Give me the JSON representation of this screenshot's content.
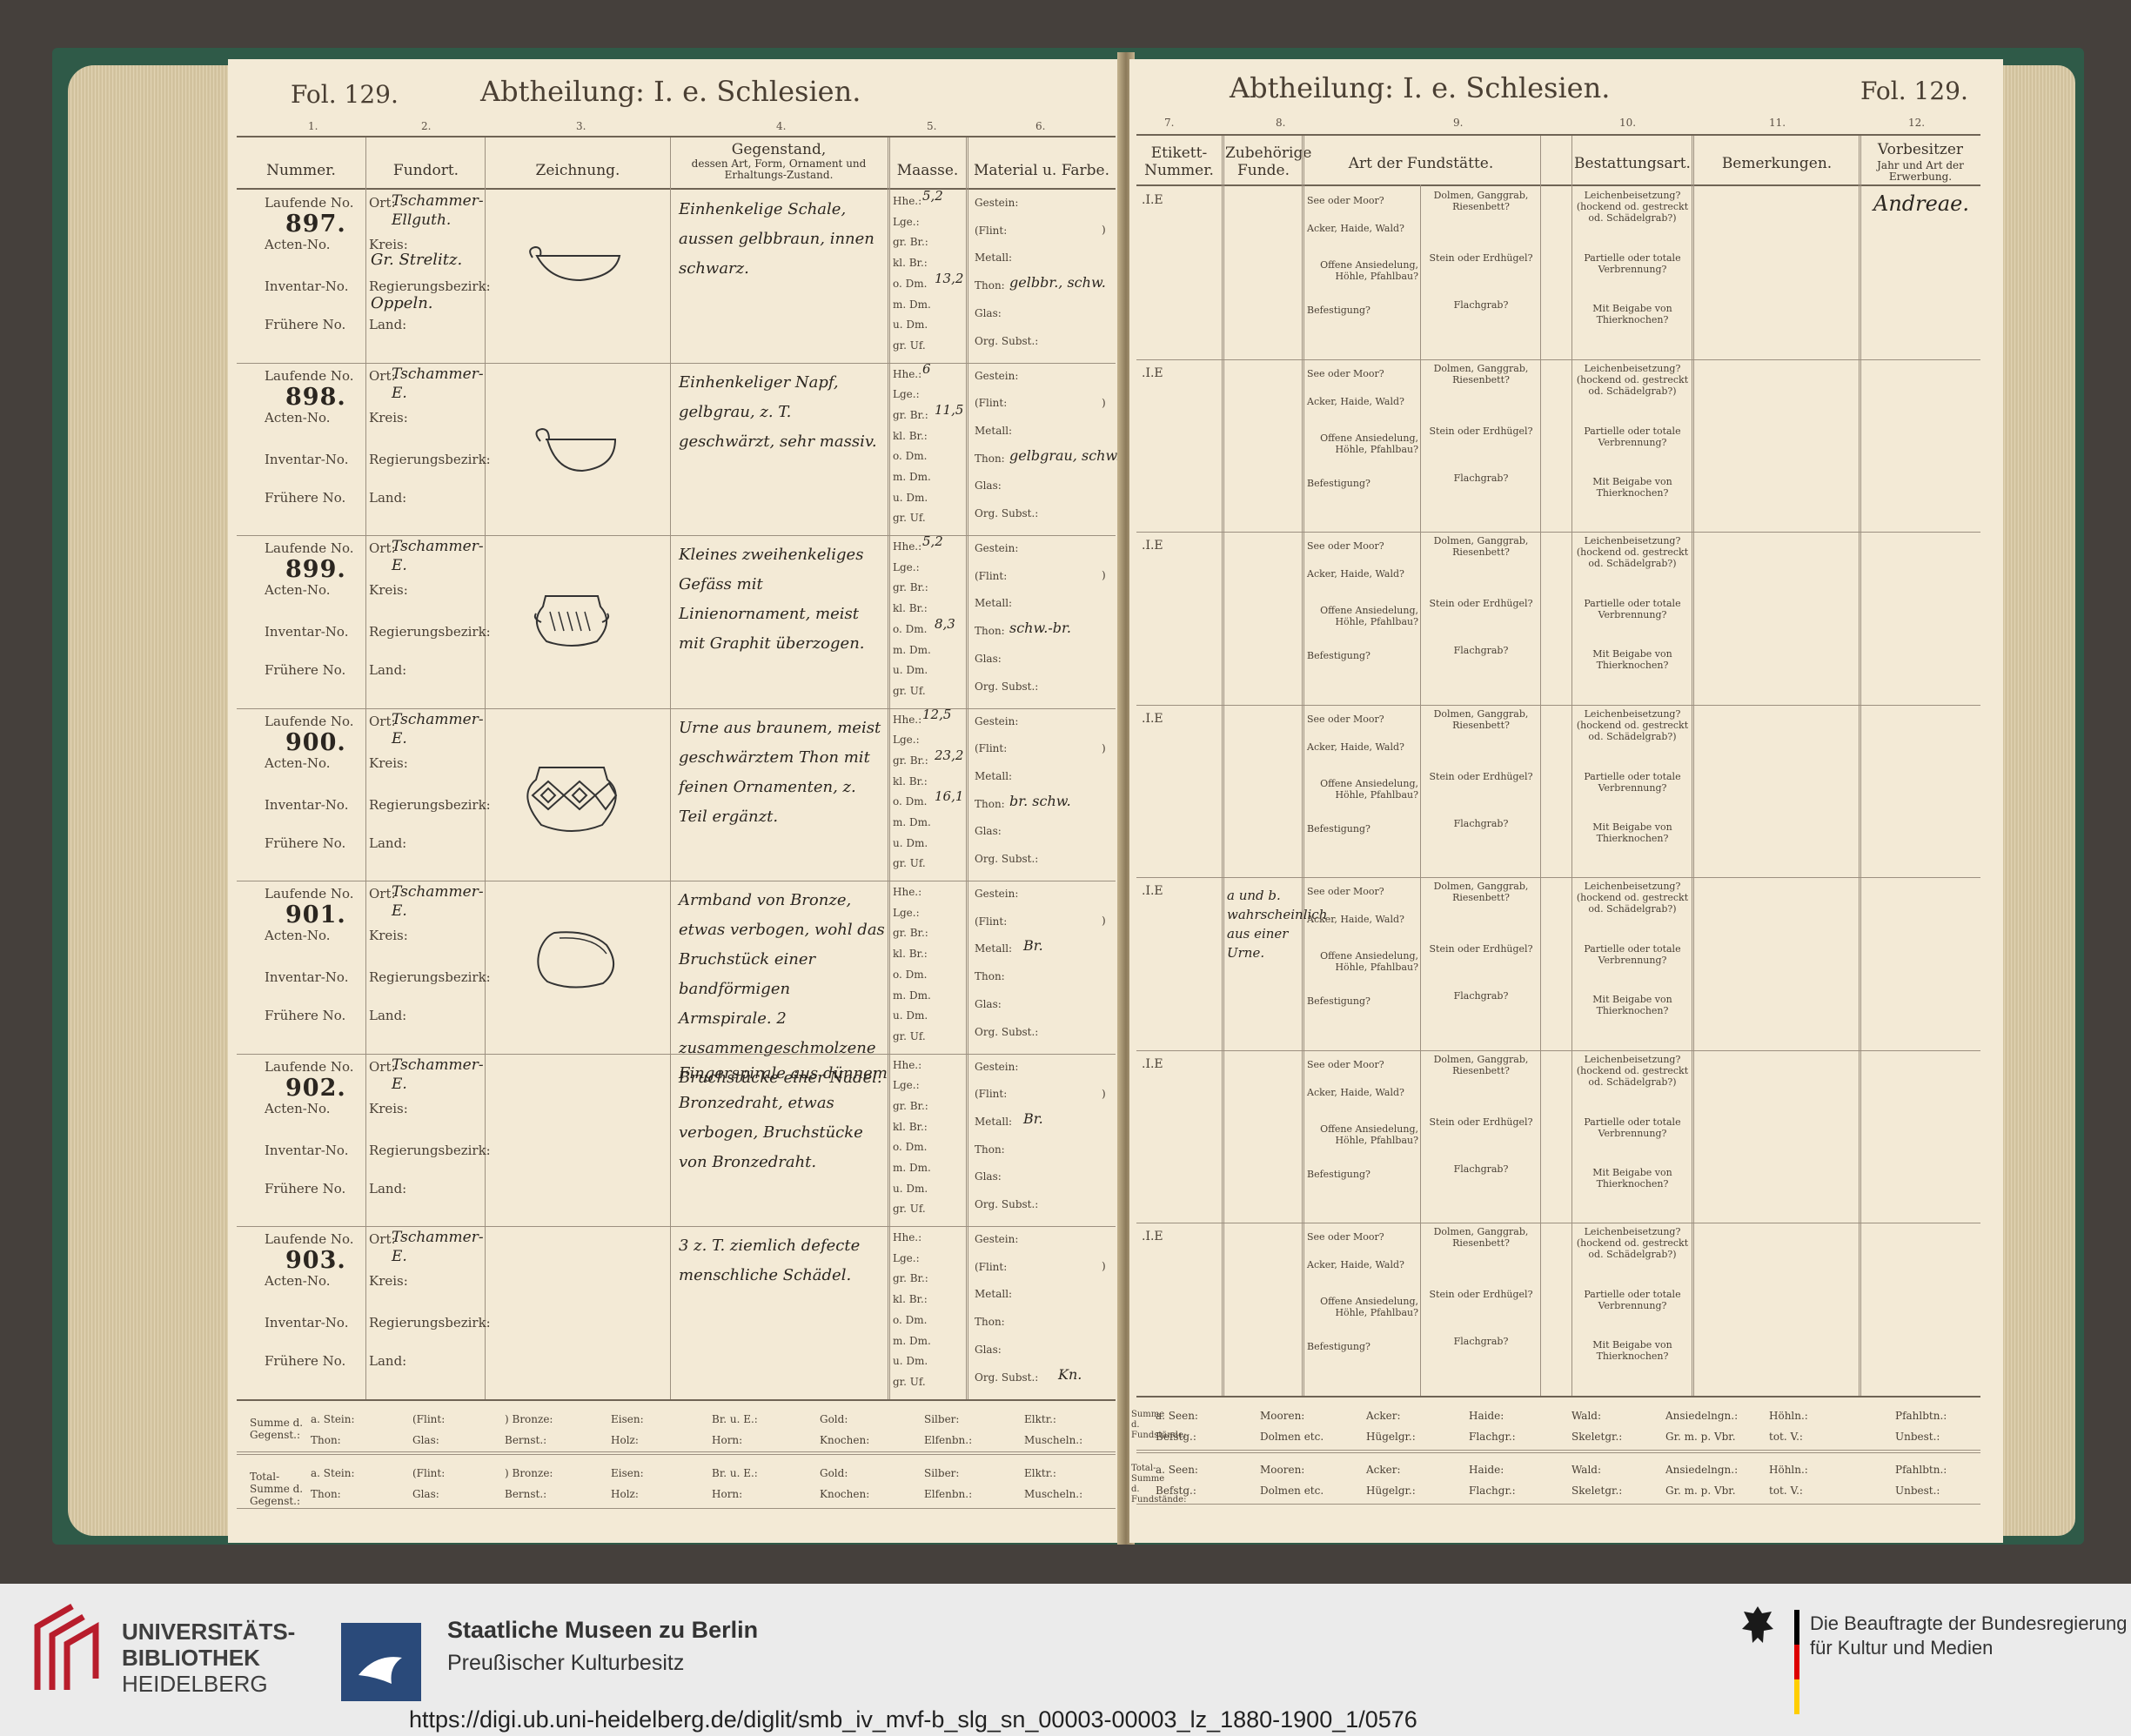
{
  "left_page": {
    "fol_label": "Fol. 129.",
    "section_title": "Abtheilung: I. e. Schlesien.",
    "column_numbers": [
      "1.",
      "2.",
      "3.",
      "4.",
      "5.",
      "6."
    ],
    "headers": {
      "nummer": "Nummer.",
      "fundort": "Fundort.",
      "zeichnung": "Zeichnung.",
      "gegenstand_title": "Gegenstand,",
      "gegenstand_sub": "dessen Art, Form, Ornament und Erhaltungs-Zustand.",
      "maasse": "Maasse.",
      "material": "Material u. Farbe."
    },
    "row_labels": {
      "laufende": "Laufende No.",
      "acten": "Acten-No.",
      "inventar": "Inventar-No.",
      "fruehere": "Frühere No.",
      "ort": "Ort:",
      "kreis": "Kreis:",
      "regbez": "Regierungsbezirk:",
      "land": "Land:"
    },
    "maasse_labels": [
      "Hhe.:",
      "Lge.:",
      "gr. Br.:",
      "kl. Br.:",
      "o. Dm.",
      "m. Dm.",
      "u. Dm.",
      "gr. Uf."
    ],
    "material_labels": [
      "Gestein:",
      "(Flint:",
      "Metall:",
      "Thon:",
      "Glas:",
      "Org. Subst.:"
    ],
    "entries": [
      {
        "number": "897.",
        "ort": "Tschammer-Ellguth.",
        "kreis": "Gr. Strelitz.",
        "regbez": "Oppeln.",
        "description": "Einhenkelige Schale, aussen gelbbraun, innen schwarz.",
        "maasse": {
          "Hhe.:": "5,2",
          "o. Dm.": "13,2"
        },
        "material": {
          "Thon:": "gelbbr., schw."
        }
      },
      {
        "number": "898.",
        "ort": "Tschammer-E.",
        "kreis": "",
        "regbez": "",
        "description": "Einhenkeliger Napf, gelbgrau, z. T. geschwärzt, sehr massiv.",
        "maasse": {
          "Hhe.:": "6",
          "gr. Br.:": "11,5"
        },
        "material": {
          "Thon:": "gelbgrau, schw."
        }
      },
      {
        "number": "899.",
        "ort": "Tschammer-E.",
        "kreis": "",
        "regbez": "",
        "description": "Kleines zweihenkeliges Gefäss mit Linienornament, meist mit Graphit überzogen.",
        "maasse": {
          "Hhe.:": "5,2",
          "o. Dm.": "8,3"
        },
        "material": {
          "Thon:": "schw.-br."
        }
      },
      {
        "number": "900.",
        "ort": "Tschammer-E.",
        "kreis": "",
        "regbez": "",
        "description": "Urne aus braunem, meist geschwärztem Thon mit feinen Ornamenten, z. Teil ergänzt.",
        "maasse": {
          "Hhe.:": "12,5",
          "gr. Br.:": "23,2",
          "o. Dm.": "16,1"
        },
        "material": {
          "Thon:": "br. schw."
        }
      },
      {
        "number": "901.",
        "ort": "Tschammer-E.",
        "kreis": "",
        "regbez": "",
        "description": "Armband von Bronze, etwas verbogen, wohl das Bruchstück einer bandförmigen Armspirale. 2 zusammengeschmolzene Bruchstücke einer Nadel.",
        "maasse": {},
        "material": {
          "Metall:": "Br."
        }
      },
      {
        "number": "902.",
        "ort": "Tschammer-E.",
        "kreis": "",
        "regbez": "",
        "description": "Fingerspirale aus dünnem Bronzedraht, etwas verbogen, Bruchstücke von Bronzedraht.",
        "maasse": {},
        "material": {
          "Metall:": "Br."
        }
      },
      {
        "number": "903.",
        "ort": "Tschammer-E.",
        "kreis": "",
        "regbez": "",
        "description": "3 z. T. ziemlich defecte menschliche Schädel.",
        "maasse": {},
        "material": {
          "Org. Subst.:": "Kn."
        }
      }
    ],
    "summe_label": "Summe d. Gegenst.:",
    "total_label": "Total-Summe d. Gegenst.:",
    "summe_row1": [
      "a. Stein:",
      "(Flint:",
      ") Bronze:",
      "Eisen:",
      "Br. u. E.:",
      "Gold:",
      "Silber:",
      "Elktr.:"
    ],
    "summe_row2": [
      "Thon:",
      "Glas:",
      "Bernst.:",
      "Holz:",
      "Horn:",
      "Knochen:",
      "Elfenbn.:",
      "Muscheln.:"
    ]
  },
  "right_page": {
    "fol_label": "Fol. 129.",
    "section_title": "Abtheilung: I. e. Schlesien.",
    "column_numbers": [
      "7.",
      "8.",
      "9.",
      "10.",
      "11.",
      "12."
    ],
    "headers": {
      "etikett": "Etikett-Nummer.",
      "zubehoerige": "Zubehörige Funde.",
      "fundstaette": "Art der Fundstätte.",
      "bestattung": "Bestattungsart.",
      "bemerkungen": "Bemerkungen.",
      "vorbesitzer_title": "Vorbesitzer",
      "vorbesitzer_sub": "Jahr und Art der Erwerbung."
    },
    "etikett_mark": ".I.E",
    "fundstaette_a": [
      "See oder Moor?",
      "Acker, Haide, Wald?",
      "Offene Ansiedelung, Höhle, Pfahlbau?",
      "Befestigung?"
    ],
    "fundstaette_b": [
      "Dolmen, Ganggrab, Riesenbett?",
      "Stein oder Erdhügel?",
      "Flachgrab?"
    ],
    "bestattung_labels": [
      "Leichenbeisetzung? (hockend od. gestreckt od. Schädelgrab?)",
      "Partielle oder totale Verbrennung?",
      "Mit Beigabe von Thierknochen?"
    ],
    "vorbesitzer_first": "Andreae.",
    "zubehoerige_901": "a und b. wahrscheinlich aus einer Urne.",
    "summe_row1": [
      "a. Seen:",
      "Mooren:",
      "Acker:",
      "Haide:",
      "Wald:",
      "Ansiedelngn.:",
      "Höhln.:",
      "Pfahlbtn.:"
    ],
    "summe_row2": [
      "Befstg.:",
      "Dolmen etc.",
      "Hügelgr.:",
      "Flachgr.:",
      "Skeletgr.:",
      "Gr. m. p. Vbr.",
      "tot. V.:",
      "Unbest.:"
    ],
    "summe_label": "Summe d. Fundstände:",
    "total_label": "Total-Summe d. Fundstände:"
  },
  "footer": {
    "ub_line1": "UNIVERSITÄTS-",
    "ub_line2": "BIBLIOTHEK",
    "ub_line3": "HEIDELBERG",
    "smb_line1": "Staatliche Museen zu Berlin",
    "smb_line2": "Preußischer Kulturbesitz",
    "bkm_line1": "Die Beauftragte der Bundesregierung",
    "bkm_line2": "für Kultur und Medien",
    "url": "https://digi.ub.uni-heidelberg.de/diglit/smb_iv_mvf-b_slg_sn_00003-00003_lz_1880-1900_1/0576",
    "colors": {
      "smb_blue": "#2a4a7a",
      "ub_red": "#b81d2c",
      "flag_black": "#000000",
      "flag_red": "#dd0000",
      "flag_gold": "#ffce00"
    }
  }
}
